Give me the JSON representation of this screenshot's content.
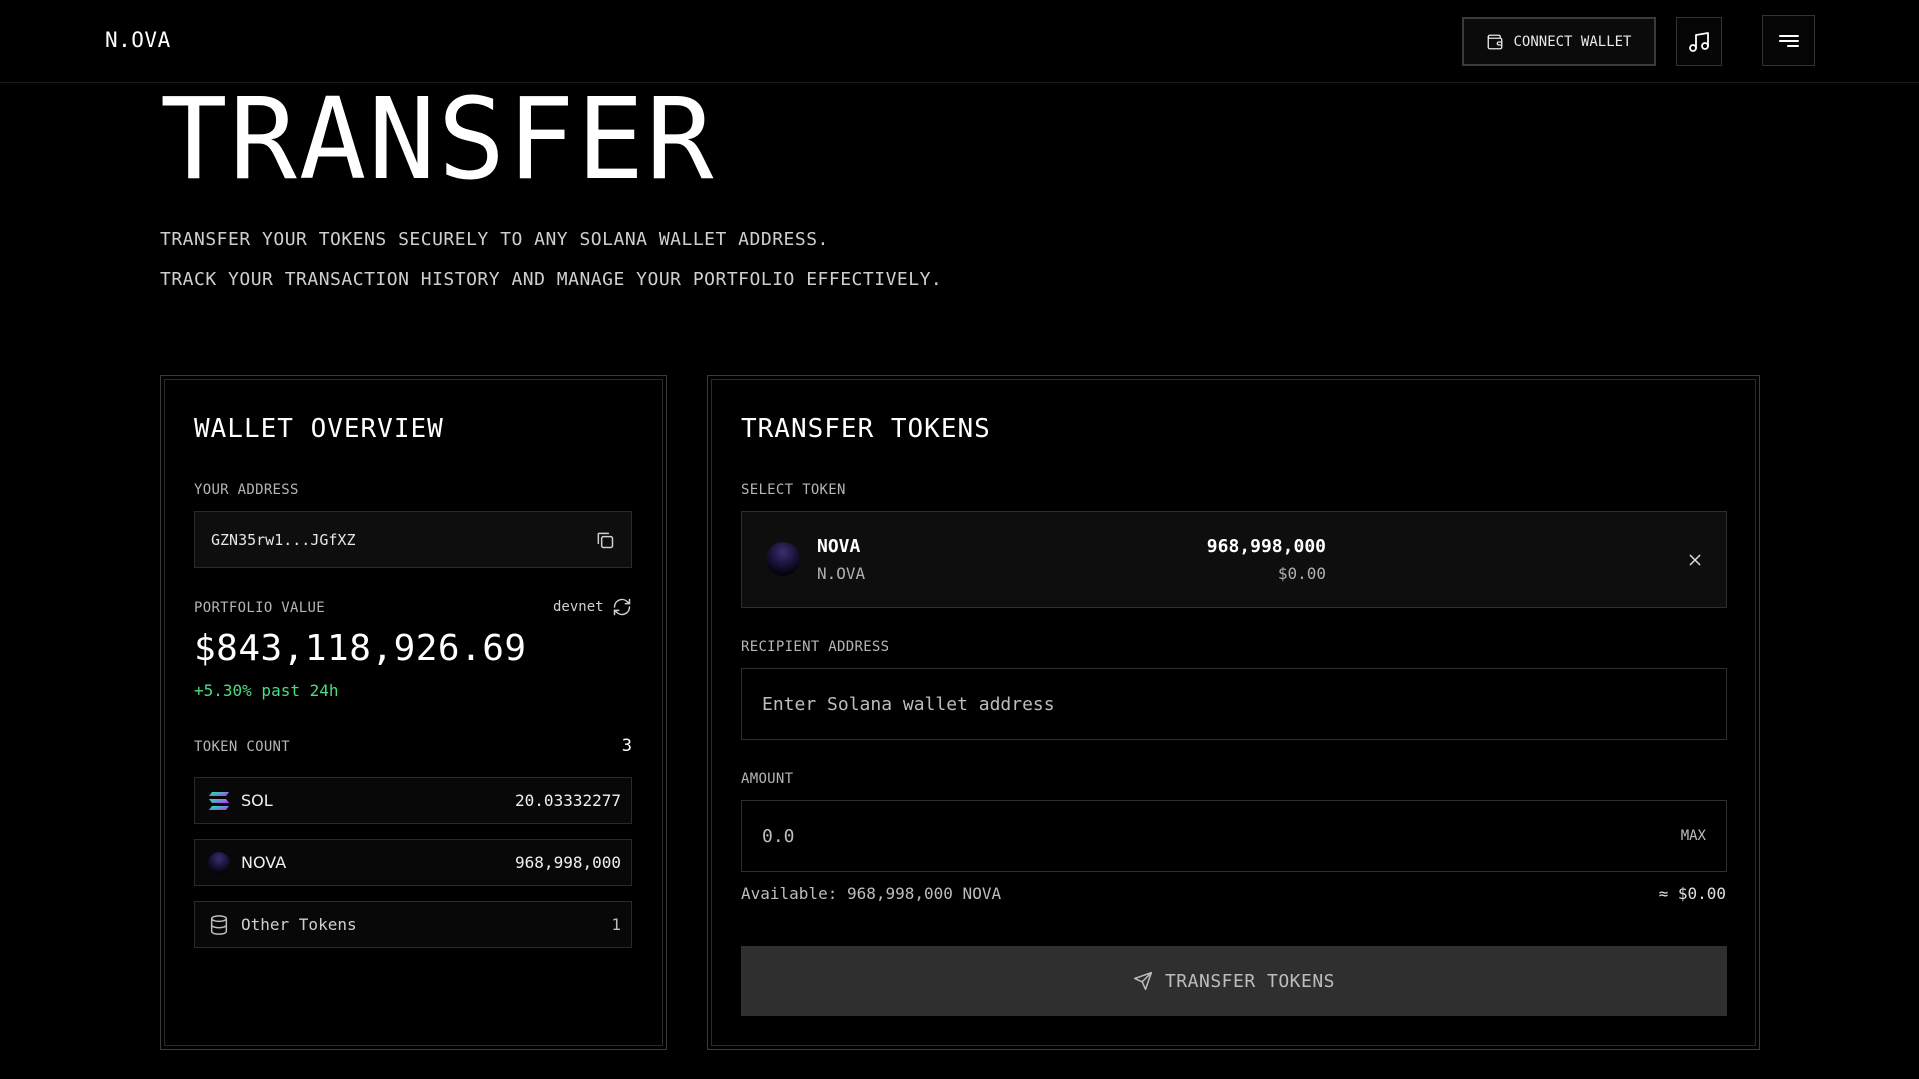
{
  "header": {
    "logo": "N.OVA",
    "connect_wallet_label": "CONNECT WALLET",
    "icons": {
      "wallet": "wallet-icon",
      "music": "music-note-icon",
      "menu": "menu-icon"
    }
  },
  "hero": {
    "title": "TRANSFER",
    "line1": "TRANSFER YOUR TOKENS SECURELY TO ANY SOLANA WALLET ADDRESS.",
    "line2": "TRACK YOUR TRANSACTION HISTORY AND MANAGE YOUR PORTFOLIO EFFECTIVELY."
  },
  "wallet_overview": {
    "title": "WALLET OVERVIEW",
    "address_label": "YOUR ADDRESS",
    "address": "GZN35rw1...JGfXZ",
    "portfolio_label": "PORTFOLIO VALUE",
    "network": "devnet",
    "portfolio_value": "$843,118,926.69",
    "change": "+5.30% past 24h",
    "token_count_label": "TOKEN COUNT",
    "token_count": "3",
    "tokens": [
      {
        "name": "SOL",
        "amount": "20.03332277",
        "icon": "solana-icon"
      },
      {
        "name": "NOVA",
        "amount": "968,998,000",
        "icon": "nova-token-icon"
      },
      {
        "name": "Other Tokens",
        "amount": "1",
        "icon": "database-icon"
      }
    ]
  },
  "transfer": {
    "title": "TRANSFER TOKENS",
    "select_label": "SELECT TOKEN",
    "selected_token": {
      "symbol": "NOVA",
      "name": "N.OVA",
      "balance": "968,998,000",
      "usd": "$0.00"
    },
    "recipient_label": "RECIPIENT ADDRESS",
    "recipient_placeholder": "Enter Solana wallet address",
    "amount_label": "AMOUNT",
    "amount_placeholder": "0.0",
    "max_label": "MAX",
    "available": "Available: 968,998,000 NOVA",
    "approx_value": "≈ $0.00",
    "submit_label": "TRANSFER TOKENS"
  },
  "colors": {
    "background": "#000000",
    "positive": "#4ade80",
    "button_bg": "#2f2f2f"
  }
}
